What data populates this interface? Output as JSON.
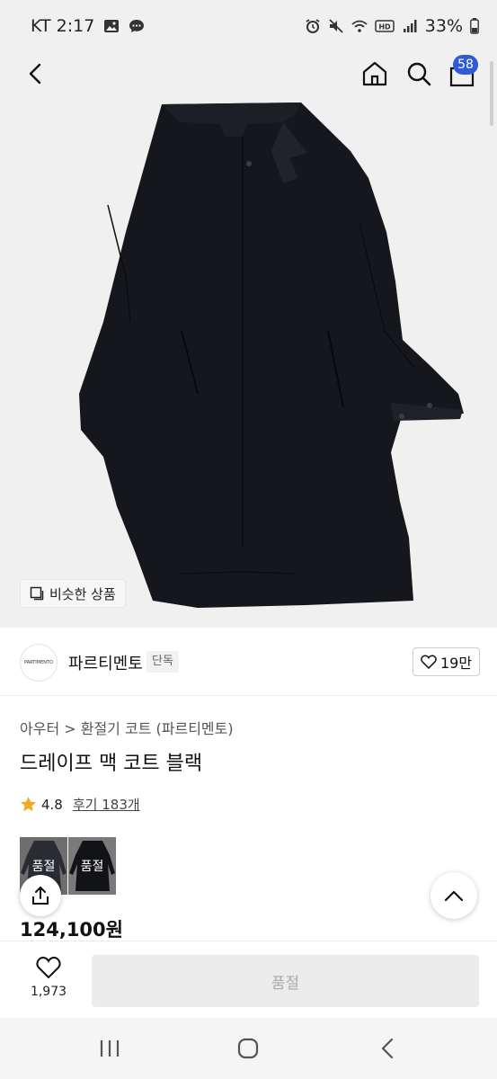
{
  "status_bar": {
    "carrier_time": "KT 2:17",
    "battery": "33%"
  },
  "header": {
    "cart_count": "58"
  },
  "hero": {
    "similar_label": "비슷한 상품"
  },
  "brand": {
    "logo_text": "PARTIMENTO",
    "name": "파르티멘토",
    "tag": "단독",
    "likes": "19만"
  },
  "product": {
    "category": "아우터 > 환절기 코트 (파르티멘토)",
    "title": "드레이프 맥 코트 블랙",
    "rating": "4.8",
    "review": "후기 183개",
    "options": [
      {
        "label": "품절"
      },
      {
        "label": "품절"
      }
    ],
    "price": "124,100원"
  },
  "action_bar": {
    "wish_count": "1,973",
    "buy_label": "품절"
  },
  "colors": {
    "badge": "#2f5bd9",
    "star": "#f5a623",
    "coat": "#15171d"
  }
}
